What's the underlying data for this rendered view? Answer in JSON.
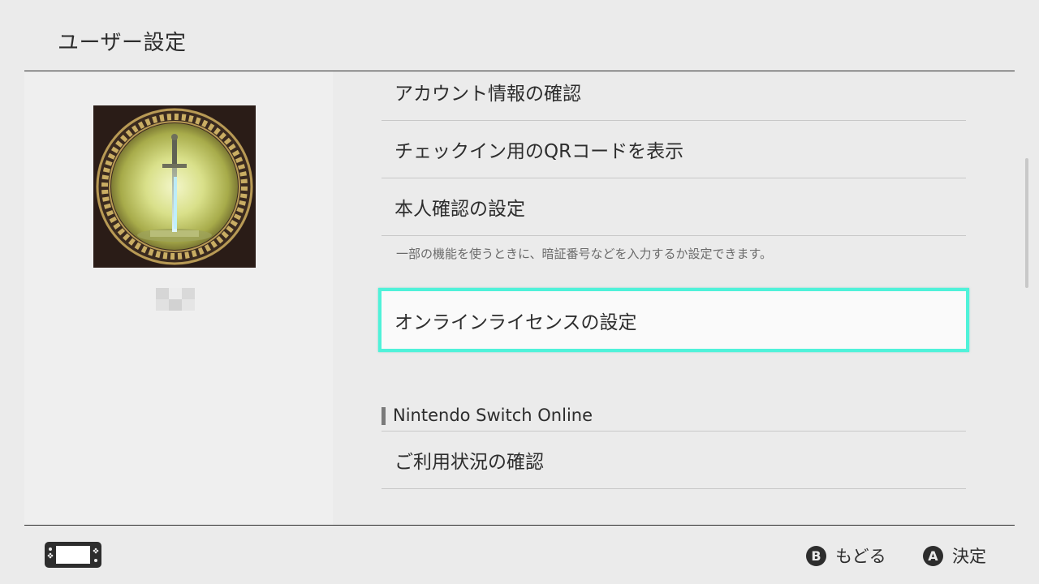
{
  "header": {
    "title": "ユーザー設定"
  },
  "menu": {
    "items": [
      {
        "label": "アカウント情報の確認"
      },
      {
        "label": "チェックイン用のQRコードを表示"
      },
      {
        "label": "本人確認の設定"
      }
    ],
    "identity_description": "一部の機能を使うときに、暗証番号などを入力するか設定できます。",
    "selected_item": {
      "label": "オンラインライセンスの設定"
    },
    "section": {
      "title": "Nintendo Switch Online",
      "items": [
        {
          "label": "ご利用状況の確認"
        }
      ]
    }
  },
  "footer": {
    "back": {
      "button": "B",
      "label": "もどる"
    },
    "confirm": {
      "button": "A",
      "label": "決定"
    }
  },
  "colors": {
    "background": "#ebebeb",
    "selection_border": "#4ff2d9",
    "text": "#2d2d2d"
  },
  "icons": {
    "console": "nintendo-switch-console-icon",
    "avatar": "master-sword-avatar-image"
  }
}
